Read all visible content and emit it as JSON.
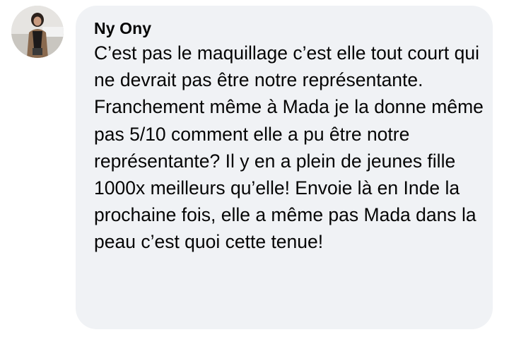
{
  "comment": {
    "author": "Ny Ony",
    "text": "C’est pas le maquillage c’est elle tout court qui ne devrait pas être notre représentante. Franchement même à Mada je la donne même pas 5/10 comment elle a pu être notre représentante? Il y en a plein de jeunes fille 1000x meilleurs qu’elle! Envoie là en Inde la prochaine fois, elle a même pas Mada dans la peau c’est quoi cette tenue!"
  },
  "colors": {
    "bubble": "#f0f2f5",
    "text": "#050505"
  }
}
